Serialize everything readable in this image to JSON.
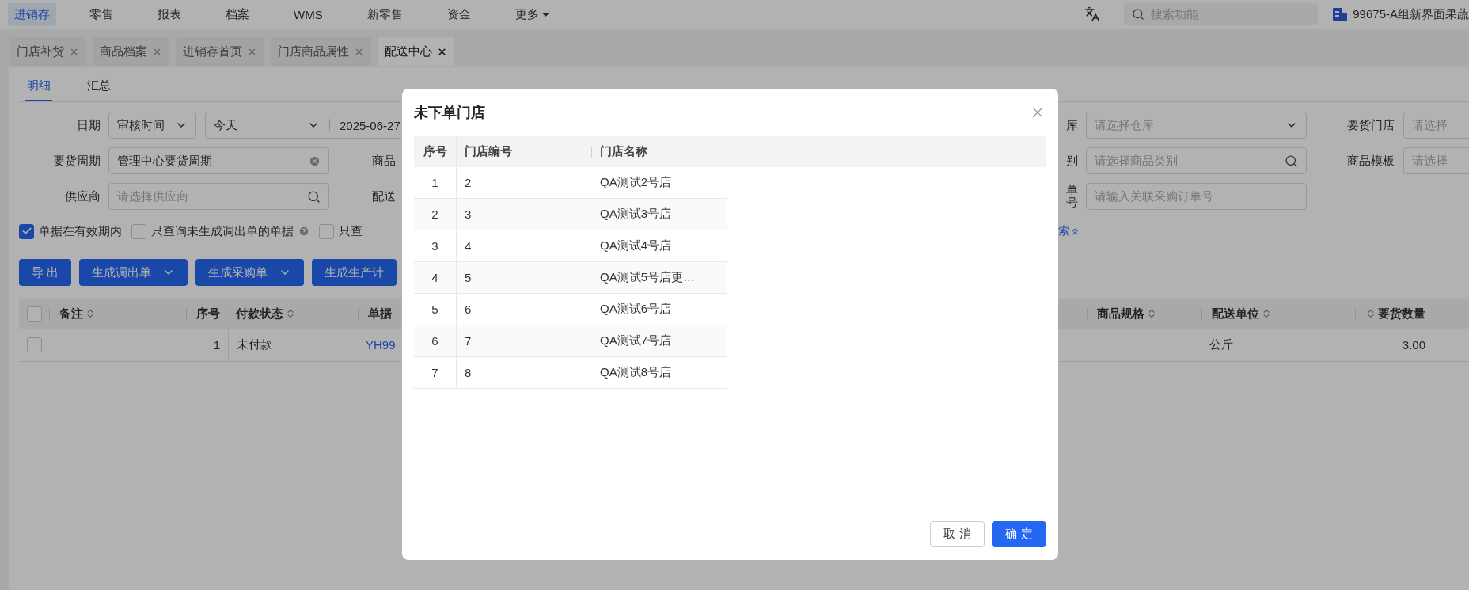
{
  "top_nav": {
    "items": [
      {
        "label": "进销存",
        "selected": true,
        "kind": "link"
      },
      {
        "label": "零售",
        "selected": false,
        "kind": "link"
      },
      {
        "label": "报表",
        "selected": false,
        "kind": "link"
      },
      {
        "label": "档案",
        "selected": false,
        "kind": "link"
      },
      {
        "label": "WMS",
        "selected": false,
        "kind": "link"
      },
      {
        "label": "新零售",
        "selected": false,
        "kind": "link"
      },
      {
        "label": "资金",
        "selected": false,
        "kind": "link"
      },
      {
        "label": "更多",
        "selected": false,
        "kind": "dropdown"
      }
    ],
    "search": {
      "placeholder": "搜索功能"
    },
    "org": "99675-A组新界面果蔬"
  },
  "page_tabs": [
    {
      "label": "门店补货",
      "selected": false
    },
    {
      "label": "商品档案",
      "selected": false
    },
    {
      "label": "进销存首页",
      "selected": false
    },
    {
      "label": "门店商品属性",
      "selected": false
    },
    {
      "label": "配送中心",
      "selected": true
    }
  ],
  "sub_tabs": [
    {
      "label": "明细",
      "selected": true
    },
    {
      "label": "汇总",
      "selected": false
    }
  ],
  "filters": {
    "left": [
      {
        "label": "日期",
        "kind": "date_range",
        "type_value": "审核时间",
        "preset": "今天",
        "start": "2025-06-27"
      },
      {
        "label": "要货周期",
        "kind": "clearable",
        "value": "管理中心要货周期"
      },
      {
        "label": "供应商",
        "kind": "search",
        "placeholder": "请选择供应商"
      }
    ],
    "left_cut_labels": [
      "商品",
      "配送"
    ],
    "right": [
      {
        "label": "库",
        "kind": "select",
        "placeholder": "请选择仓库"
      },
      {
        "label": "别",
        "kind": "search",
        "placeholder": "请选择商品类别"
      },
      {
        "label": "单号",
        "kind": "text",
        "placeholder": "请输入关联采购订单号"
      }
    ],
    "far_right": [
      {
        "label": "要货门店",
        "placeholder": "请选择"
      },
      {
        "label": "商品模板",
        "placeholder": "请选择"
      }
    ]
  },
  "options": [
    {
      "label": "单据在有效期内",
      "checked": true,
      "help": false
    },
    {
      "label": "只查询未生成调出单的单据",
      "checked": false,
      "help": true
    },
    {
      "label": "只查",
      "checked": false,
      "help": false
    }
  ],
  "collapse_link": "索",
  "actions": [
    {
      "label": "导 出",
      "kind": "plain"
    },
    {
      "label": "生成调出单",
      "kind": "dropdown"
    },
    {
      "label": "生成采购单",
      "kind": "dropdown"
    },
    {
      "label": "生成生产计",
      "kind": "plain"
    }
  ],
  "table": {
    "select_all_checked": false,
    "columns_left": [
      {
        "label": "备注",
        "sortable": true,
        "kind": "text"
      },
      {
        "label": "序号",
        "sortable": false,
        "kind": "number"
      },
      {
        "label": "付款状态",
        "sortable": true,
        "kind": "text"
      },
      {
        "label": "单据",
        "sortable": false,
        "kind": "text"
      }
    ],
    "columns_right": [
      {
        "label": "商品规格",
        "sortable": true,
        "kind": "text"
      },
      {
        "label": "配送单位",
        "sortable": true,
        "kind": "text"
      },
      {
        "label": "要货数量",
        "sortable": true,
        "kind": "number"
      }
    ],
    "rows": [
      {
        "checked": false,
        "index": "1",
        "payment": "未付款",
        "doc_no": "YH99",
        "unit": "公斤",
        "qty": "3.00"
      }
    ]
  },
  "modal": {
    "title": "未下单门店",
    "columns": [
      "序号",
      "门店编号",
      "门店名称"
    ],
    "rows": [
      [
        "1",
        "2",
        "QA测试2号店"
      ],
      [
        "2",
        "3",
        "QA测试3号店"
      ],
      [
        "3",
        "4",
        "QA测试4号店"
      ],
      [
        "4",
        "5",
        "QA测试5号店更…"
      ],
      [
        "5",
        "6",
        "QA测试6号店"
      ],
      [
        "6",
        "7",
        "QA测试7号店"
      ],
      [
        "7",
        "8",
        "QA测试8号店"
      ]
    ],
    "buttons": [
      {
        "label": "取 消",
        "kind": "default"
      },
      {
        "label": "确 定",
        "kind": "primary"
      }
    ]
  }
}
